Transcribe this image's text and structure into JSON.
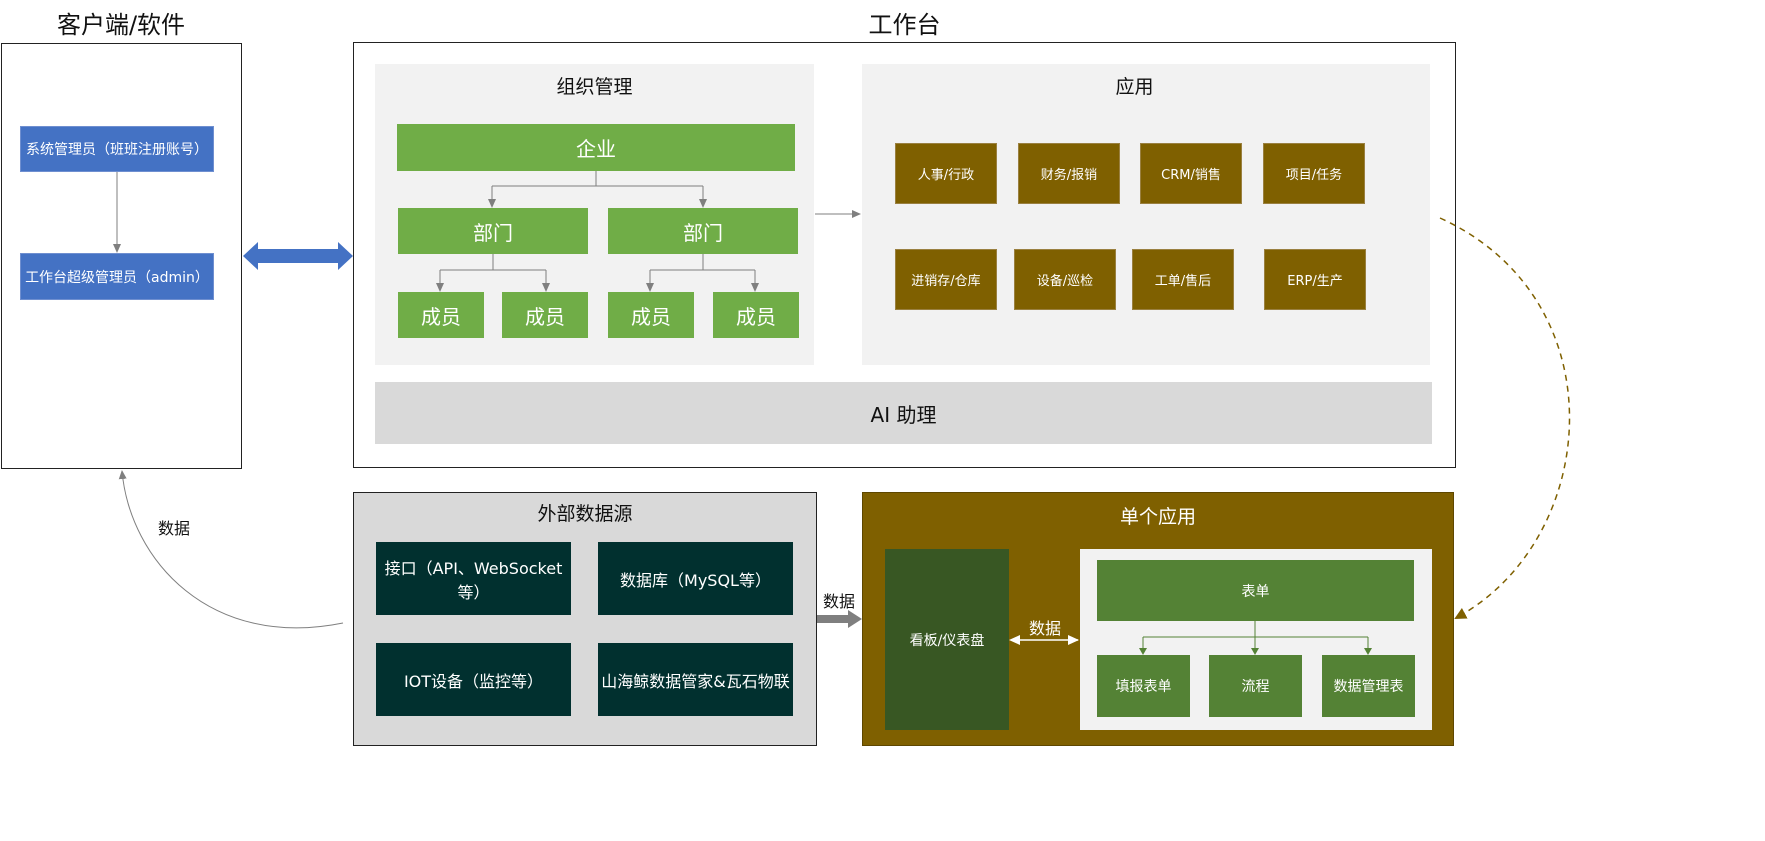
{
  "client": {
    "title": "客户端/软件",
    "sys_admin": "系统管理员（班班注册账号）",
    "super_admin": "工作台超级管理员（admin）"
  },
  "workbench": {
    "title": "工作台",
    "org": {
      "title": "组织管理",
      "enterprise": "企业",
      "dept_1": "部门",
      "dept_2": "部门",
      "members": [
        "成员",
        "成员",
        "成员",
        "成员"
      ]
    },
    "apps": {
      "title": "应用",
      "items": [
        "人事/行政",
        "财务/报销",
        "CRM/销售",
        "项目/任务",
        "进销存/仓库",
        "设备/巡检",
        "工单/售后",
        "ERP/生产"
      ]
    },
    "ai": "AI 助理"
  },
  "external": {
    "title": "外部数据源",
    "items": [
      "接口（API、WebSocket等）",
      "数据库（MySQL等）",
      "IOT设备（监控等）",
      "山海鲸数据管家&瓦石物联"
    ]
  },
  "single_app": {
    "title": "单个应用",
    "dashboard": "看板/仪表盘",
    "form": "表单",
    "children": [
      "填报表单",
      "流程",
      "数据管理表"
    ]
  },
  "labels": {
    "data_left": "数据",
    "data_mid": "数据",
    "data_inner": "数据"
  },
  "colors": {
    "blue": "#4472c4",
    "green": "#70ad47",
    "brown": "#7f6000",
    "teal": "#01302f",
    "dark_green": "#385723",
    "mid_green": "#548235"
  }
}
